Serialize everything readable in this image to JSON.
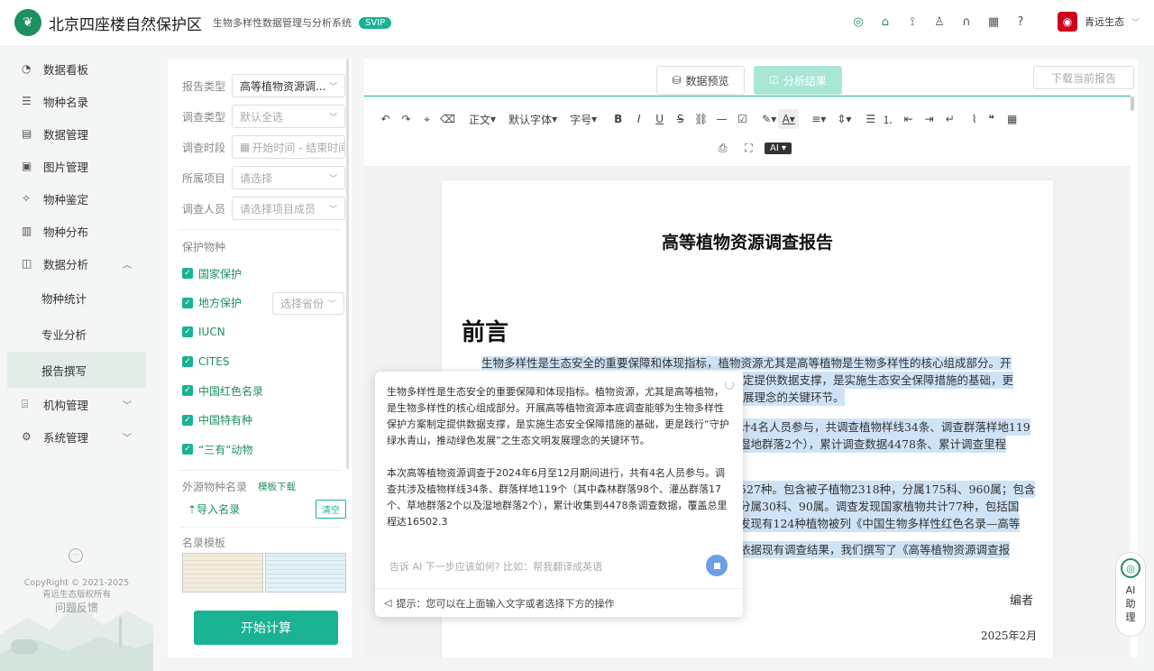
{
  "header": {
    "title": "北京四座楼自然保护区",
    "subtitle": "生物多样性数据管理与分析系统",
    "badge": "SVIP",
    "user_name": "青远生态",
    "help": "?"
  },
  "sidebar": {
    "items": [
      {
        "label": "数据看板",
        "icon": "dashboard-icon"
      },
      {
        "label": "物种名录",
        "icon": "list-icon"
      },
      {
        "label": "数据管理",
        "icon": "database-icon"
      },
      {
        "label": "图片管理",
        "icon": "image-icon"
      },
      {
        "label": "物种鉴定",
        "icon": "identify-icon"
      },
      {
        "label": "物种分布",
        "icon": "map-icon"
      },
      {
        "label": "数据分析",
        "icon": "chart-icon"
      }
    ],
    "sub_items": [
      "物种统计",
      "专业分析",
      "报告撰写"
    ],
    "active_sub": "报告撰写",
    "tail_items": [
      {
        "label": "机构管理",
        "icon": "org-icon"
      },
      {
        "label": "系统管理",
        "icon": "settings-icon"
      }
    ],
    "copyright_line1": "CopyRight © 2021-2025",
    "copyright_line2": "青远生态版权所有",
    "feedback": "问题反馈"
  },
  "filters": {
    "report_type_label": "报告类型",
    "report_type_value": "高等植物资源调...",
    "survey_type_label": "调查类型",
    "survey_type_value": "默认全选",
    "period_label": "调查时段",
    "period_placeholder": "开始时间 - 结束时间",
    "project_label": "所属项目",
    "project_placeholder": "请选择",
    "staff_label": "调查人员",
    "staff_placeholder": "请选择项目成员",
    "protect_title": "保护物种",
    "checkboxes": [
      "国家保护",
      "地方保护",
      "IUCN",
      "CITES",
      "中国红色名录",
      "中国特有种",
      "“三有”动物"
    ],
    "province_placeholder": "选择省份",
    "external_label": "外源物种名录",
    "template_download": "模板下载",
    "import_label": "导入名录",
    "clear_label": "清空",
    "template_title": "名录模板",
    "calc_button": "开始计算"
  },
  "main": {
    "tab_preview": "数据预览",
    "tab_result": "分析结果",
    "download_button": "下载当前报告",
    "toolbar": {
      "paragraph": "正文",
      "font": "默认字体",
      "size": "字号",
      "ai": "AI"
    },
    "doc": {
      "title": "高等植物资源调查报告",
      "heading": "前言",
      "para1_line1": "生物多样性是生态安全的重要保障和体现指标，植物资源尤其是高等植物是生物多样性的核心组成部分。开",
      "para1_line2": "定提供数据支撑，是实施生态安全保障措施的基础，更",
      "para1_line3": "展理念的关键环节。",
      "para2_line1": "计4名人员参与，共调查植物样线34条、调查群落样地119",
      "para2_line2": "湿地群落2个），累计调查数据4478条、累计调查里程",
      "para3_line1": "527种。包含被子植物2318种，分属175科、960属；包含",
      "para3_line2": "分属30科、90属。调查发现国家植物共计77种，包括国",
      "para3_line3": "发现有124种植物被列《中国生物多样性红色名录—高等",
      "para4_line1": "依据现有调查结果，我们撰写了《高等植物资源调查报",
      "author": "编者",
      "date": "2025年2月"
    }
  },
  "ai_popup": {
    "para1": "生物多样性是生态安全的重要保障和体现指标。植物资源，尤其是高等植物，是生物多样性的核心组成部分。开展高等植物资源本底调查能够为生物多样性保护方案制定提供数据支撑，是实施生态安全保障措施的基础，更是践行“守护绿水青山，推动绿色发展”之生态文明发展理念的关键环节。",
    "para2": "本次高等植物资源调查于2024年6月至12月期间进行，共有4名人员参与。调查共涉及植物样线34条、群落样地119个（其中森林群落98个、灌丛群落17个、草地群落2个以及湿地群落2个），累计收集到4478条调查数据，覆盖总里程达16502.3",
    "input_placeholder": "告诉 AI 下一步应该如何? 比如：帮我翻译成英语",
    "hint": "提示：您可以在上面输入文字或者选择下方的操作"
  },
  "ai_assistant": {
    "label": "AI助理"
  }
}
